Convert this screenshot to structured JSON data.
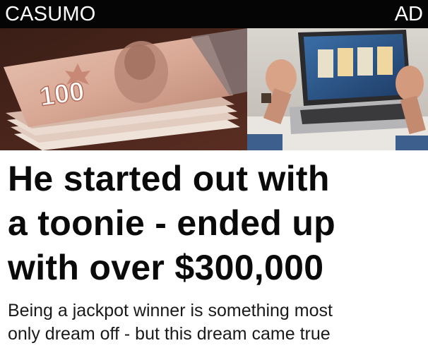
{
  "ad": {
    "brand": "CASUMO",
    "label": "AD",
    "banknote_value": "100",
    "headline_lines": [
      "He started out with",
      "a toonie - ended up",
      "with over $300,000"
    ],
    "description_lines": [
      "Being a jackpot winner is something most",
      "only dream off - but this dream came true"
    ]
  },
  "colors": {
    "bar": "#050505",
    "banknote": "#c9a08c",
    "background": "#ffffff"
  },
  "icons": [
    "banknote-image",
    "laptop-player-image"
  ]
}
